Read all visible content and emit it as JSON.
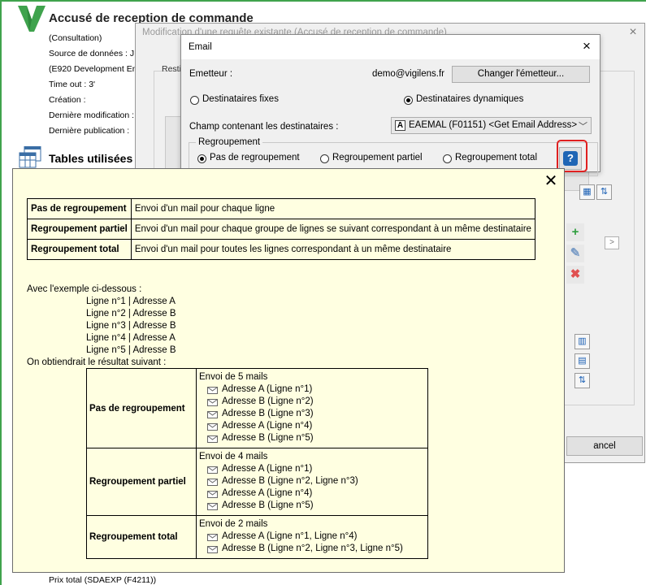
{
  "background": {
    "title": "Accusé de reception de commande",
    "lines": [
      "(Consultation)",
      "Source de données : J",
      "(E920 Development En",
      "Time out : 3'",
      "Création :",
      "Dernière modification :",
      "Dernière publication :"
    ],
    "tables_title": "Tables utilisées",
    "bottom_item": "Prix total (SDAEXP (F4211))"
  },
  "middle_dialog": {
    "title": "Modification d'une requête existante (Accusé de reception de commande)",
    "close": "×",
    "restricted_label": "Resti",
    "cancel_label": "ancel",
    "toolbar_icons": [
      "table-icon",
      "calendar-icon",
      "sort-icon"
    ]
  },
  "email_dialog": {
    "title": "Email",
    "close": "×",
    "emetteur_label": "Emetteur :",
    "emetteur_value": "demo@vigilens.fr",
    "change_sender_label": "Changer l'émetteur...",
    "recipient_options": [
      {
        "label": "Destinataires fixes",
        "selected": false
      },
      {
        "label": "Destinataires dynamiques",
        "selected": true
      }
    ],
    "champ_label": "Champ contenant les destinataires :",
    "champ_icon": "A",
    "champ_value": "EAEMAL (F01151) <Get Email Address>",
    "regroupement_legend": "Regroupement",
    "regroupement_options": [
      {
        "label": "Pas de regroupement",
        "selected": true
      },
      {
        "label": "Regroupement partiel",
        "selected": false
      },
      {
        "label": "Regroupement total",
        "selected": false
      }
    ],
    "help_glyph": "?"
  },
  "help_popup": {
    "close": "✕",
    "definitions": [
      {
        "term": "Pas de regroupement",
        "description": "Envoi d'un mail pour chaque ligne"
      },
      {
        "term": "Regroupement partiel",
        "description": "Envoi d'un mail pour chaque groupe de lignes se suivant correspondant à un même destinataire"
      },
      {
        "term": "Regroupement total",
        "description": "Envoi d'un mail pour toutes les lignes correspondant à un même destinataire"
      }
    ],
    "example_intro": "Avec l'exemple ci-dessous :",
    "example_lines": [
      "Ligne n°1 | Adresse A",
      "Ligne n°2 | Adresse B",
      "Ligne n°3 | Adresse B",
      "Ligne n°4 | Adresse A",
      "Ligne n°5 | Adresse B"
    ],
    "result_intro": "On obtiendrait le résultat suivant :",
    "results": [
      {
        "term": "Pas de regroupement",
        "summary": "Envoi de 5 mails",
        "mails": [
          "Adresse A (Ligne n°1)",
          "Adresse B (Ligne n°2)",
          "Adresse B (Ligne n°3)",
          "Adresse A (Ligne n°4)",
          "Adresse B (Ligne n°5)"
        ]
      },
      {
        "term": "Regroupement partiel",
        "summary": "Envoi de 4 mails",
        "mails": [
          "Adresse A (Ligne n°1)",
          "Adresse B (Ligne n°2, Ligne n°3)",
          "Adresse A (Ligne n°4)",
          "Adresse B (Ligne n°5)"
        ]
      },
      {
        "term": "Regroupement total",
        "summary": "Envoi de 2 mails",
        "mails": [
          "Adresse A (Ligne n°1, Ligne n°4)",
          "Adresse B (Ligne n°2, Ligne n°3, Ligne n°5)"
        ]
      }
    ]
  },
  "colors": {
    "popup_background": "#ffffe1",
    "help_button_blue": "#1f66b5",
    "highlight_red": "#e02020",
    "app_green": "#3fa34d"
  }
}
